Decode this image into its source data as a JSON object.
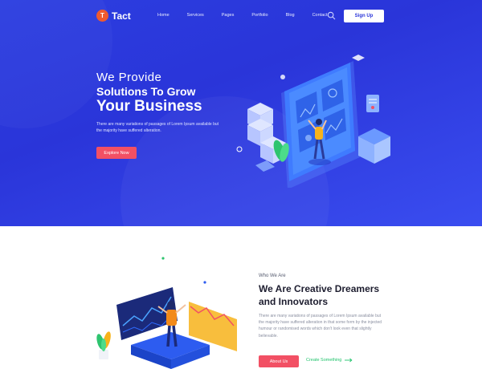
{
  "brand": {
    "badge": "T",
    "name": "Tact",
    "badge_color": "#ef5a2f"
  },
  "nav": {
    "links": [
      "Home",
      "Services",
      "Pages",
      "Portfolio",
      "Blog",
      "Contact"
    ],
    "signup": "Sign Up",
    "search_icon": "search-icon"
  },
  "hero": {
    "pre": "We Provide",
    "mid": "Solutions To Grow",
    "big": "Your Business",
    "desc": "There are many variations of passages of Lorem Ipsum available but the majority have suffered alteration.",
    "button": "Explore Now",
    "bg": "#2a35d9",
    "accent": "#f25064"
  },
  "about": {
    "eyebrow": "Who We Are",
    "title": "We Are Creative Dreamers and Innovators",
    "desc": "There are many variations of passages of Lorem Ipsum available but the majority have suffered alteration in that some form by the injected humour or randomised words which don't look even that slightly believable.",
    "button": "About Us",
    "link": "Create Something",
    "link_color": "#1fc36b"
  }
}
